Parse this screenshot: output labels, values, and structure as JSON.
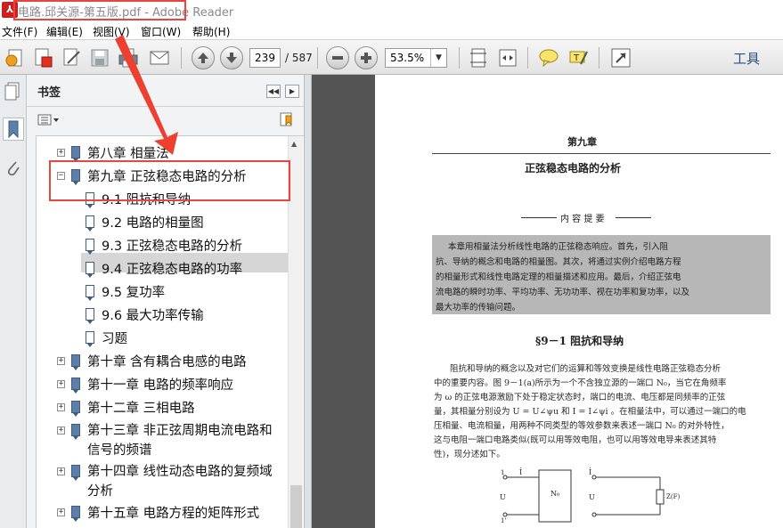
{
  "window": {
    "title": "电路.邱关源-第五版.pdf - Adobe Reader",
    "app_icon": "adobe-reader-icon"
  },
  "menu": [
    "文件(F)",
    "编辑(E)",
    "视图(V)",
    "窗口(W)",
    "帮助(H)"
  ],
  "toolbar": {
    "page_current": "239",
    "page_total": "/ 587",
    "zoom": "53.5%",
    "tools_label": "工具",
    "icons": [
      "create-icon",
      "convert-icon",
      "sign-icon",
      "save-icon",
      "print-icon",
      "email-icon",
      "page-up-icon",
      "page-down-icon",
      "zoom-out-icon",
      "zoom-in-icon",
      "fit-page-icon",
      "fit-width-icon",
      "comment-icon",
      "highlight-icon",
      "fullscreen-icon"
    ]
  },
  "bookmarks": {
    "title": "书签",
    "items": [
      {
        "label": "第八章 相量法",
        "level": 0,
        "expander": "+"
      },
      {
        "label": "第九章 正弦稳态电路的分析",
        "level": 0,
        "expander": "−"
      },
      {
        "label": "9.1 阻抗和导纳",
        "level": 1,
        "selected": true
      },
      {
        "label": "9.2 电路的相量图",
        "level": 1
      },
      {
        "label": "9.3 正弦稳态电路的分析",
        "level": 1
      },
      {
        "label": "9.4 正弦稳态电路的功率",
        "level": 1
      },
      {
        "label": "9.5 复功率",
        "level": 1
      },
      {
        "label": "9.6 最大功率传输",
        "level": 1
      },
      {
        "label": "习题",
        "level": 1
      },
      {
        "label": "第十章 含有耦合电感的电路",
        "level": 0,
        "expander": "+"
      },
      {
        "label": "第十一章 电路的频率响应",
        "level": 0,
        "expander": "+"
      },
      {
        "label": "第十二章 三相电路",
        "level": 0,
        "expander": "+"
      },
      {
        "label": "第十三章 非正弦周期电流电路和信号的频谱",
        "level": 0,
        "expander": "+"
      },
      {
        "label": "第十四章 线性动态电路的复频域分析",
        "level": 0,
        "expander": "+"
      },
      {
        "label": "第十五章 电路方程的矩阵形式",
        "level": 0,
        "expander": "+"
      }
    ]
  },
  "document": {
    "chapter_header": "第九章",
    "chapter_title": "正弦稳态电路的分析",
    "summary_heading": "内 容 提 要",
    "summary_lines": [
      "本章用相量法分析线性电路的正弦稳态响应。首先，引入阻",
      "抗、导纳的概念和电路的相量图。其次，将通过实例介绍电路方程",
      "的相量形式和线性电路定理的相量描述和应用。最后，介绍正弦电",
      "流电路的瞬时功率、平均功率、无功功率、视在功率和复功率，以及",
      "最大功率的传输问题。"
    ],
    "section_title": "§9－1  阻抗和导纳",
    "body_lines": [
      "阻抗和导纳的概念以及对它们的运算和等效变换是线性电路正弦稳态分析",
      "中的重要内容。图 9－1(a)所示为一个不含独立源的一端口 N₀，当它在角频率",
      "为 ω 的正弦电源激励下处于稳定状态时，端口的电流、电压都是同频率的正弦",
      "量，其相量分别设为 U = U∠ψu 和 I = I∠ψi 。在相量法中，可以通过一端口的电",
      "压相量、电流相量，用两种不同类型的等效参数来表述一端口 N₀ 的对外特性，",
      "这与电阻一端口电路类似(既可以用等效电阻，也可以用等效电导来表述其特",
      "性)，现分述如下。"
    ],
    "figure_labels": {
      "box": "N₀",
      "u": "U",
      "i": "İ",
      "z": "Z(F)",
      "t1": "1",
      "t2": "1'"
    }
  }
}
